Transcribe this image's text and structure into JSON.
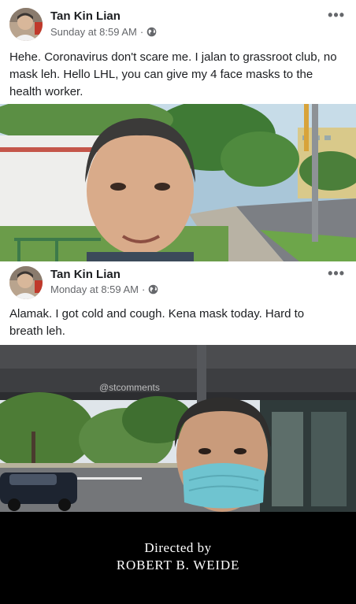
{
  "posts": [
    {
      "author": "Tan Kin Lian",
      "timestamp": "Sunday at 8:59 AM",
      "separator": "·",
      "privacy_icon": "globe-icon",
      "more_label": "•••",
      "text": "Hehe. Coronavirus don't scare me. I jalan to grassroot club, no mask leh. Hello LHL, you can give my 4 face masks to the health worker."
    },
    {
      "author": "Tan Kin Lian",
      "timestamp": "Monday at 8:59 AM",
      "separator": "·",
      "privacy_icon": "globe-icon",
      "more_label": "•••",
      "text": "Alamak. I got cold and cough. Kena mask today. Hard to breath leh."
    }
  ],
  "watermark": "@stcomments",
  "credits": {
    "line1": "Directed by",
    "line2": "ROBERT B. WEIDE"
  },
  "colors": {
    "text": "#1c1e21",
    "meta": "#65676b",
    "credits_bg": "#000000",
    "mask": "#6fc4d0"
  }
}
